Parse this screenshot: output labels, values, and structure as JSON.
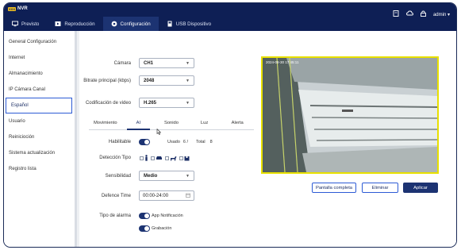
{
  "app": {
    "logo_badge": "XXX",
    "logo_text": "NVR"
  },
  "tabs": [
    {
      "label": "Previsto",
      "icon": "monitor-icon"
    },
    {
      "label": "Reproducción",
      "icon": "playback-icon"
    },
    {
      "label": "Configuración",
      "icon": "gear-icon"
    },
    {
      "label": "USB Dispositivo",
      "icon": "usb-icon"
    }
  ],
  "header_right": {
    "user": "admin"
  },
  "sidebar": {
    "items": [
      {
        "label": "General Configuración"
      },
      {
        "label": "Internet"
      },
      {
        "label": "Almanacimiento"
      },
      {
        "label": "IP Cámara Canal"
      },
      {
        "label": "Español"
      },
      {
        "label": "Usuario"
      },
      {
        "label": "Reinicioción"
      },
      {
        "label": "Sistema actualización"
      },
      {
        "label": "Registro lista"
      }
    ]
  },
  "form": {
    "camera": {
      "label": "Cámara",
      "value": "CH1"
    },
    "bitrate": {
      "label": "Bitrate principal (kbps)",
      "value": "2048"
    },
    "codec": {
      "label": "Codificación de video",
      "value": "H.265"
    }
  },
  "subtabs": [
    {
      "label": "Movimiento"
    },
    {
      "label": "AI"
    },
    {
      "label": "Sonido"
    },
    {
      "label": "Luz"
    },
    {
      "label": "Alerta"
    }
  ],
  "ai": {
    "enable_label": "Habilitable",
    "used_label": "Usado",
    "used_value": "6 /",
    "total_label": "Total",
    "total_value": "8",
    "detection_label": "Detección Tipo",
    "sensitivity_label": "Sensibilidad",
    "sensitivity_value": "Medio",
    "defence_label": "Defence Time",
    "defence_value": "00:00-24:00",
    "alarm_type_label": "Tipo de alarma",
    "alarm_app": "App Notificación",
    "alarm_record": "Grabación"
  },
  "preview": {
    "timestamp": "2024-08-30 17:45:11"
  },
  "buttons": {
    "fullscreen": "Pantalla completa",
    "delete": "Eliminar",
    "apply": "Aplicar"
  },
  "colors": {
    "navy": "#0e1f55",
    "accent": "#1c3372",
    "preview_border": "#e8e000"
  }
}
